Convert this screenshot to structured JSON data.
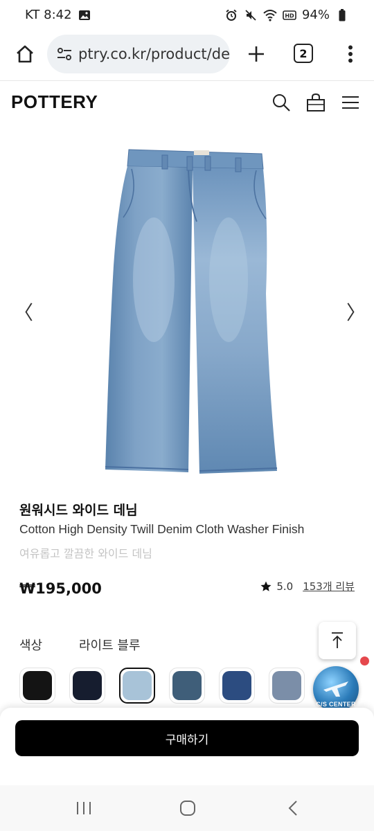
{
  "status": {
    "carrier_time": "KT 8:42",
    "battery": "94%",
    "icons": [
      "gallery-icon",
      "alarm-icon",
      "mute-icon",
      "wifi-icon",
      "hd-icon",
      "battery-icon"
    ]
  },
  "browser": {
    "url": "ptry.co.kr/product/de",
    "tab_count": "2"
  },
  "site": {
    "logo": "POTTERY"
  },
  "gallery": {
    "prev": "〈",
    "next": "〉"
  },
  "product": {
    "title": "원워시드 와이드 데님",
    "subtitle": "Cotton High Density Twill Denim Cloth Washer Finish",
    "description": "여유롭고 깔끔한 와이드 데님",
    "price": "₩195,000",
    "rating": "5.0",
    "reviews": "153개 리뷰"
  },
  "color": {
    "label": "색상",
    "selected": "라이트 블루",
    "swatches": [
      {
        "name": "black",
        "hex": "#141414"
      },
      {
        "name": "navy",
        "hex": "#161d2f"
      },
      {
        "name": "light-blue",
        "hex": "#a8c3d8",
        "selected": true
      },
      {
        "name": "slate-blue",
        "hex": "#3f5e79"
      },
      {
        "name": "mid-blue",
        "hex": "#2c4c80"
      },
      {
        "name": "grey-blue",
        "hex": "#7b8ea8"
      }
    ]
  },
  "cs": {
    "label": "C/S CENTER"
  },
  "buy": {
    "label": "구매하기"
  }
}
